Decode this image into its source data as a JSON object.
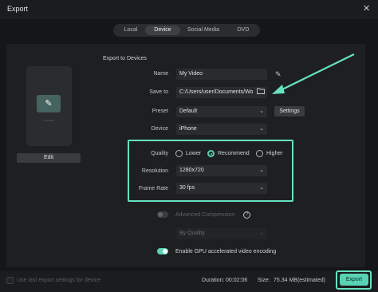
{
  "window": {
    "title": "Export",
    "close_glyph": "✕"
  },
  "tabs": [
    {
      "label": "Local",
      "active": false
    },
    {
      "label": "Device",
      "active": true
    },
    {
      "label": "Social Media",
      "active": false
    },
    {
      "label": "DVD",
      "active": false
    }
  ],
  "preview": {
    "icon": "edit-pen-icon",
    "edit_label": "Edit"
  },
  "section_title": "Export to Devices",
  "form": {
    "name_label": "Name",
    "name_value": "My Video",
    "save_label": "Save to",
    "save_value": "C:/Users/user/Documents/Wo",
    "preset_label": "Preset",
    "preset_value": "Default",
    "settings_label": "Settings",
    "device_label": "Device",
    "device_value": "iPhone"
  },
  "quality": {
    "label": "Quality",
    "options": [
      "Lower",
      "Recommend",
      "Higher"
    ],
    "selected": "Recommend"
  },
  "resolution": {
    "label": "Resolution",
    "value": "1280x720"
  },
  "frame_rate": {
    "label": "Frame Rate",
    "value": "30 fps"
  },
  "advanced": {
    "label": "Advanced Compression",
    "enabled": false,
    "mode_value": "By Quality"
  },
  "gpu": {
    "label": "Enable GPU accelerated video encoding",
    "enabled": true
  },
  "footer": {
    "checkbox_label": "Use last export settings for device",
    "duration_label": "Duration:",
    "duration_value": "00:02:06",
    "size_label": "Size:",
    "size_value": "75.34 MB(estimated)",
    "export_label": "Export"
  },
  "colors": {
    "accent": "#58d4b5",
    "highlight": "#66e2c0"
  },
  "icons": {
    "chevron": "⌄",
    "info": "?",
    "ai": "✎"
  }
}
